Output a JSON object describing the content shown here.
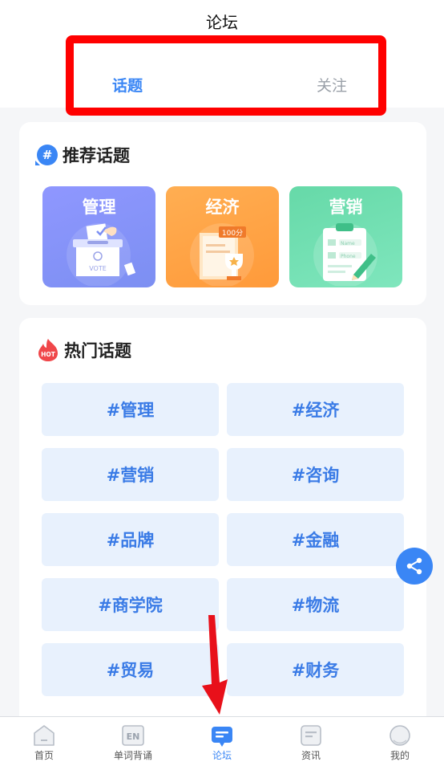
{
  "header": {
    "title": "论坛",
    "tabs": [
      {
        "label": "话题",
        "active": true
      },
      {
        "label": "关注",
        "active": false
      }
    ]
  },
  "recommended": {
    "title": "推荐话题",
    "icon": "hash-icon",
    "tiles": [
      {
        "label": "管理",
        "art_text": "VOTE"
      },
      {
        "label": "经济",
        "art_text": "100分"
      },
      {
        "label": "营销",
        "art_text_1": "Name",
        "art_text_2": "Phone"
      }
    ]
  },
  "hot": {
    "title": "热门话题",
    "icon_text": "HOT",
    "topics": [
      "#管理",
      "#经济",
      "#营销",
      "#咨询",
      "#品牌",
      "#金融",
      "#商学院",
      "#物流",
      "#贸易",
      "#财务"
    ]
  },
  "tabbar": {
    "items": [
      {
        "label": "首页",
        "icon": "home-icon",
        "active": false
      },
      {
        "label": "单词背诵",
        "icon": "en-icon",
        "icon_text": "EN",
        "active": false
      },
      {
        "label": "论坛",
        "icon": "forum-icon",
        "active": true
      },
      {
        "label": "资讯",
        "icon": "news-icon",
        "active": false
      },
      {
        "label": "我的",
        "icon": "profile-icon",
        "active": false
      }
    ]
  },
  "colors": {
    "accent": "#3a86f5",
    "highlight_box": "#ff0000",
    "topic_bg": "#e8f1fd"
  }
}
